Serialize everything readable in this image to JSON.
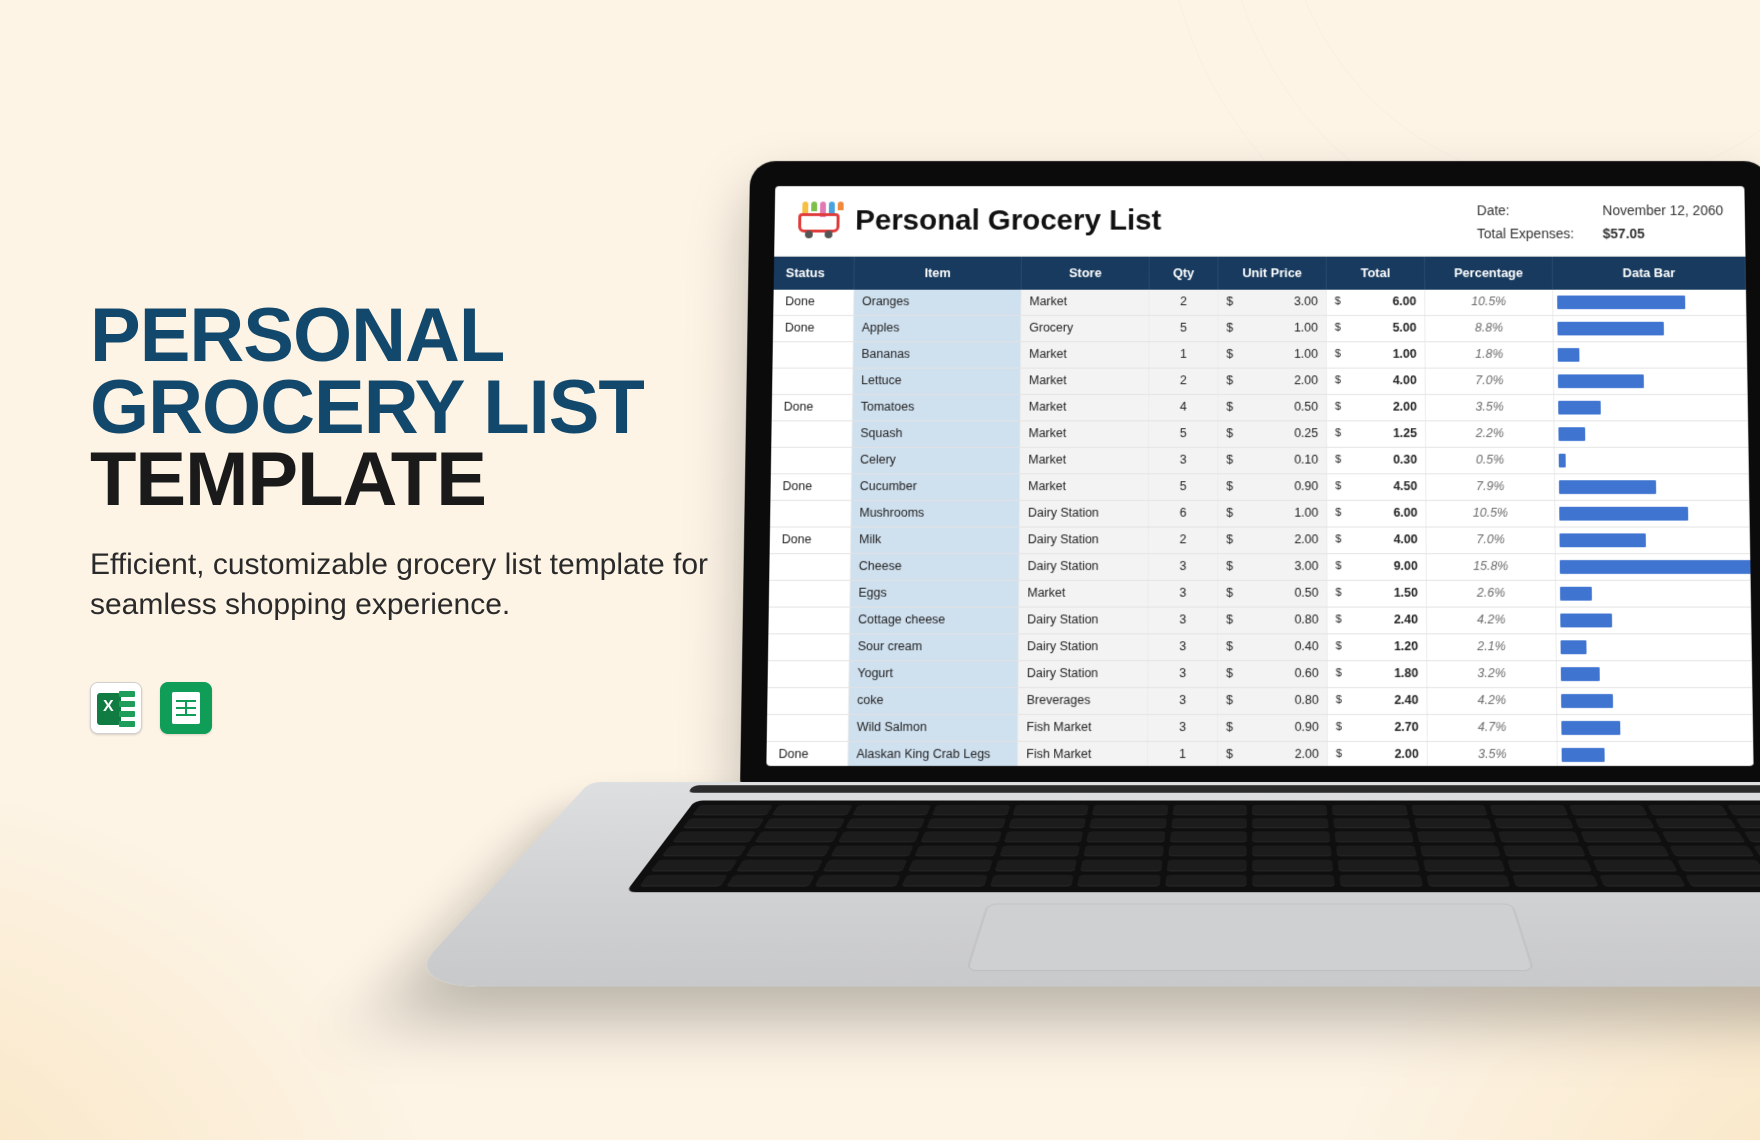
{
  "promo": {
    "headline_line1": "Personal",
    "headline_line2": "Grocery List",
    "headline_line3": "Template",
    "subtext": "Efficient, customizable grocery list template for seamless shopping experience.",
    "icons": {
      "excel": "excel-icon",
      "sheets": "google-sheets-icon"
    }
  },
  "sheet": {
    "title": "Personal Grocery List",
    "meta": {
      "date_label": "Date:",
      "date_value": "November 12, 2060",
      "total_label": "Total Expenses:",
      "total_value": "$57.05"
    },
    "columns": [
      "Status",
      "Item",
      "Store",
      "Qty",
      "Unit Price",
      "Total",
      "Percentage",
      "Data Bar"
    ],
    "currency": "$",
    "rows": [
      {
        "status": "Done",
        "item": "Oranges",
        "store": "Market",
        "qty": "2",
        "price": "3.00",
        "total": "6.00",
        "pct": "10.5%"
      },
      {
        "status": "Done",
        "item": "Apples",
        "store": "Grocery",
        "qty": "5",
        "price": "1.00",
        "total": "5.00",
        "pct": "8.8%"
      },
      {
        "status": "",
        "item": "Bananas",
        "store": "Market",
        "qty": "1",
        "price": "1.00",
        "total": "1.00",
        "pct": "1.8%"
      },
      {
        "status": "",
        "item": "Lettuce",
        "store": "Market",
        "qty": "2",
        "price": "2.00",
        "total": "4.00",
        "pct": "7.0%"
      },
      {
        "status": "Done",
        "item": "Tomatoes",
        "store": "Market",
        "qty": "4",
        "price": "0.50",
        "total": "2.00",
        "pct": "3.5%"
      },
      {
        "status": "",
        "item": "Squash",
        "store": "Market",
        "qty": "5",
        "price": "0.25",
        "total": "1.25",
        "pct": "2.2%"
      },
      {
        "status": "",
        "item": "Celery",
        "store": "Market",
        "qty": "3",
        "price": "0.10",
        "total": "0.30",
        "pct": "0.5%"
      },
      {
        "status": "Done",
        "item": "Cucumber",
        "store": "Market",
        "qty": "5",
        "price": "0.90",
        "total": "4.50",
        "pct": "7.9%"
      },
      {
        "status": "",
        "item": "Mushrooms",
        "store": "Dairy Station",
        "qty": "6",
        "price": "1.00",
        "total": "6.00",
        "pct": "10.5%"
      },
      {
        "status": "Done",
        "item": "Milk",
        "store": "Dairy Station",
        "qty": "2",
        "price": "2.00",
        "total": "4.00",
        "pct": "7.0%"
      },
      {
        "status": "",
        "item": "Cheese",
        "store": "Dairy Station",
        "qty": "3",
        "price": "3.00",
        "total": "9.00",
        "pct": "15.8%"
      },
      {
        "status": "",
        "item": "Eggs",
        "store": "Market",
        "qty": "3",
        "price": "0.50",
        "total": "1.50",
        "pct": "2.6%"
      },
      {
        "status": "",
        "item": "Cottage cheese",
        "store": "Dairy Station",
        "qty": "3",
        "price": "0.80",
        "total": "2.40",
        "pct": "4.2%"
      },
      {
        "status": "",
        "item": "Sour cream",
        "store": "Dairy Station",
        "qty": "3",
        "price": "0.40",
        "total": "1.20",
        "pct": "2.1%"
      },
      {
        "status": "",
        "item": "Yogurt",
        "store": "Dairy Station",
        "qty": "3",
        "price": "0.60",
        "total": "1.80",
        "pct": "3.2%"
      },
      {
        "status": "",
        "item": "coke",
        "store": "Breverages",
        "qty": "3",
        "price": "0.80",
        "total": "2.40",
        "pct": "4.2%"
      },
      {
        "status": "",
        "item": "Wild Salmon",
        "store": "Fish Market",
        "qty": "3",
        "price": "0.90",
        "total": "2.70",
        "pct": "4.7%"
      },
      {
        "status": "Done",
        "item": "Alaskan King Crab Legs",
        "store": "Fish Market",
        "qty": "1",
        "price": "2.00",
        "total": "2.00",
        "pct": "3.5%"
      }
    ]
  },
  "colors": {
    "header_navy": "#173a5e",
    "item_fill": "#cfe0ef",
    "bar": "#3f74d1"
  }
}
